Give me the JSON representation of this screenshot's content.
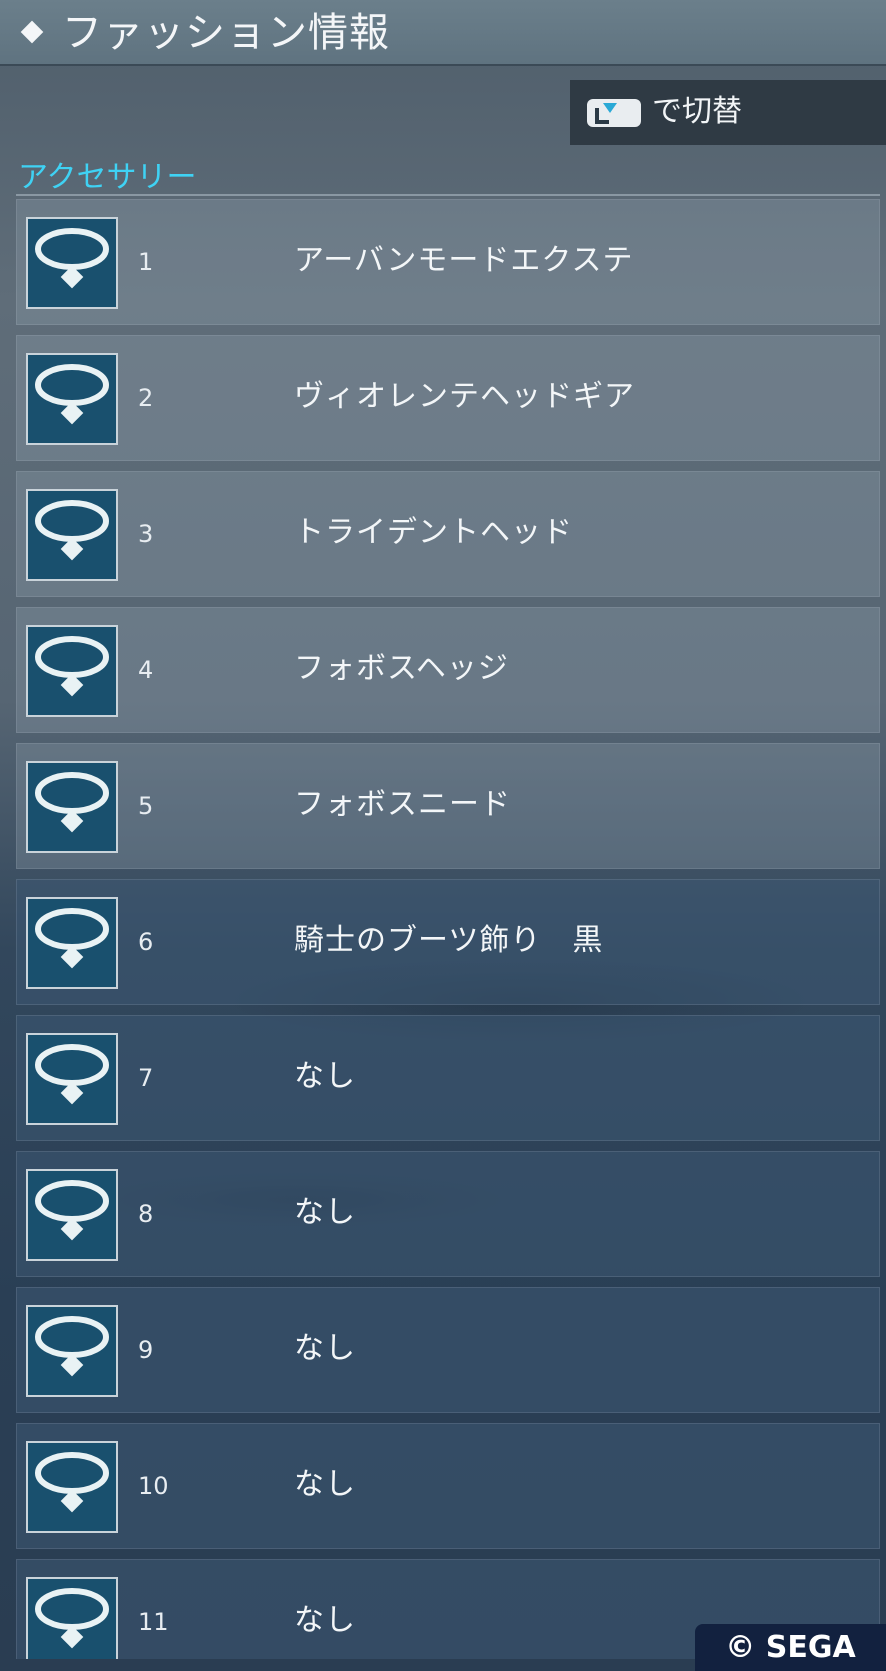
{
  "header": {
    "title": "ファッション情報"
  },
  "switch": {
    "button_icon": "l-button-icon",
    "label": "で切替"
  },
  "section": {
    "label": "アクセサリー"
  },
  "items": [
    {
      "number": "1",
      "name": "アーバンモードエクステ",
      "icon": "necklace-icon"
    },
    {
      "number": "2",
      "name": "ヴィオレンテヘッドギア",
      "icon": "necklace-icon"
    },
    {
      "number": "3",
      "name": "トライデントヘッド",
      "icon": "necklace-icon"
    },
    {
      "number": "4",
      "name": "フォボスヘッジ",
      "icon": "necklace-icon"
    },
    {
      "number": "5",
      "name": "フォボスニード",
      "icon": "necklace-icon"
    },
    {
      "number": "6",
      "name": "騎士のブーツ飾り　黒",
      "icon": "necklace-icon"
    },
    {
      "number": "7",
      "name": "なし",
      "icon": "necklace-icon"
    },
    {
      "number": "8",
      "name": "なし",
      "icon": "necklace-icon"
    },
    {
      "number": "9",
      "name": "なし",
      "icon": "necklace-icon"
    },
    {
      "number": "10",
      "name": "なし",
      "icon": "necklace-icon"
    },
    {
      "number": "11",
      "name": "なし",
      "icon": "necklace-icon"
    }
  ],
  "footer": {
    "copyright": "© SEGA"
  },
  "colors": {
    "accent": "#3fd2f4",
    "icon_bg": "#19506e",
    "header_bg": "#667a87"
  }
}
